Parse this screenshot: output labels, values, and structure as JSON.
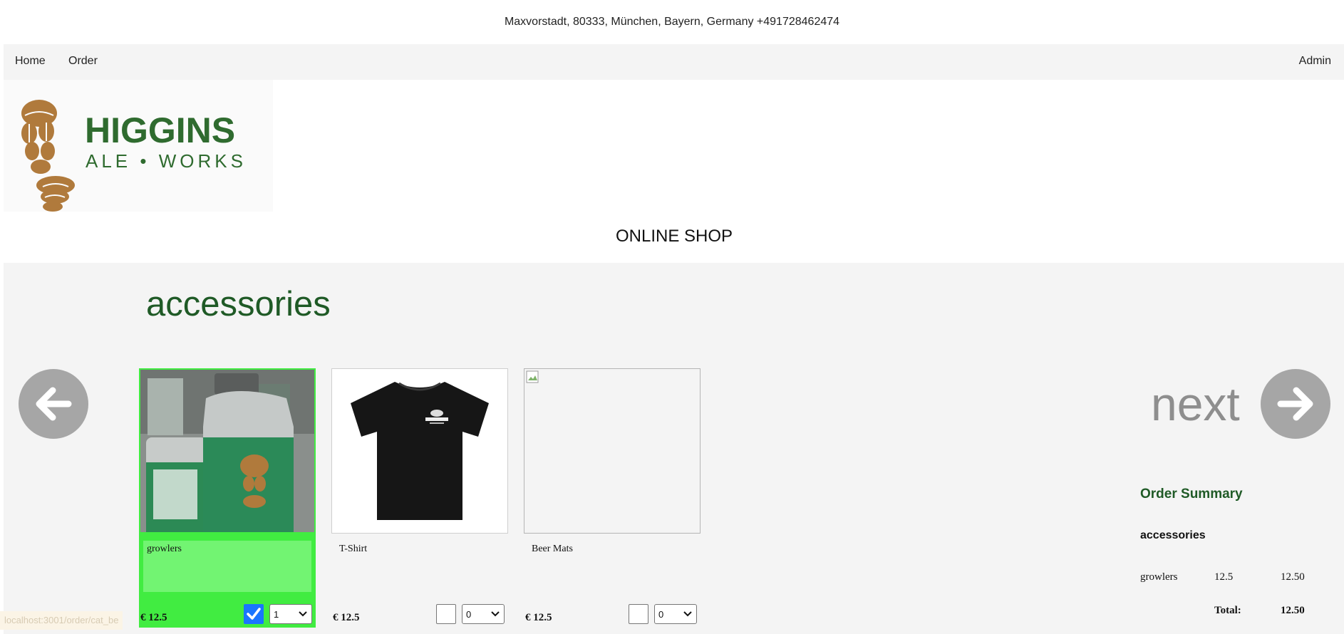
{
  "header": {
    "address": "Maxvorstadt, 80333, München, Bayern, Germany +491728462474"
  },
  "nav": {
    "home": "Home",
    "order": "Order",
    "admin": "Admin"
  },
  "logo": {
    "brand": "HIGGINS",
    "subtitle": "ALE • WORKS"
  },
  "shop_title": "ONLINE SHOP",
  "category": {
    "title": "accessories"
  },
  "pager": {
    "next_label": "next"
  },
  "products": [
    {
      "name": "growlers",
      "price": "€ 12.5",
      "selected": true,
      "qty": "1"
    },
    {
      "name": "T-Shirt",
      "price": "€ 12.5",
      "selected": false,
      "qty": "0"
    },
    {
      "name": "Beer Mats",
      "price": "€ 12.5",
      "selected": false,
      "qty": "0"
    }
  ],
  "summary": {
    "title": "Order Summary",
    "category": "accessories",
    "items": [
      {
        "name": "growlers",
        "unit": "12.5",
        "total": "12.50"
      }
    ],
    "total_label": "Total:",
    "total_value": "12.50"
  },
  "status_bar": {
    "url": "localhost:3001/order/cat_be"
  },
  "colors": {
    "accent_green": "#1f5a26",
    "selected_green": "#41ec41",
    "logo_brown": "#b07a3c",
    "arrow_gray": "#a6a6a6"
  }
}
